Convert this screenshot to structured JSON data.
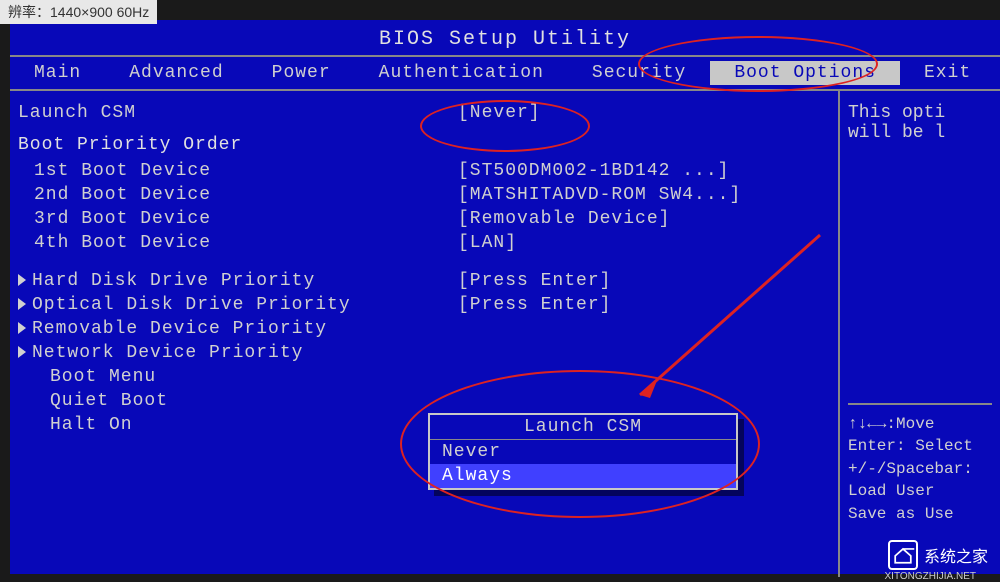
{
  "monitor_label": "辨率：1440×900 60Hz",
  "title": "BIOS Setup Utility",
  "menu": {
    "items": [
      "Main",
      "Advanced",
      "Power",
      "Authentication",
      "Security",
      "Boot Options",
      "Exit"
    ],
    "active_index": 5
  },
  "settings": {
    "launch_csm": {
      "label": "Launch CSM",
      "value": "[Never]"
    },
    "section_header": "Boot Priority Order",
    "boot_devices": [
      {
        "label": "1st Boot Device",
        "value": "[ST500DM002-1BD142   ...]"
      },
      {
        "label": "2nd Boot Device",
        "value": "[MATSHITADVD-ROM SW4...]"
      },
      {
        "label": "3rd Boot Device",
        "value": "[Removable Device]"
      },
      {
        "label": "4th Boot Device",
        "value": "[LAN]"
      }
    ],
    "submenus": [
      {
        "label": "Hard Disk Drive Priority",
        "value": "[Press Enter]"
      },
      {
        "label": "Optical Disk Drive Priority",
        "value": "[Press Enter]"
      },
      {
        "label": "Removable Device Priority",
        "value": ""
      },
      {
        "label": "Network Device Priority",
        "value": ""
      }
    ],
    "extra": [
      {
        "label": "Boot Menu"
      },
      {
        "label": "Quiet Boot"
      },
      {
        "label": "Halt On"
      }
    ]
  },
  "popup": {
    "title": "Launch CSM",
    "options": [
      "Never",
      "Always"
    ],
    "selected_index": 1
  },
  "help_panel": {
    "description": "This opti\nwill be l",
    "keys": [
      "↑↓←→:Move",
      "Enter: Select",
      "+/-/Spacebar:",
      "   Load User",
      "   Save as Use"
    ]
  },
  "watermark": {
    "text": "系统之家",
    "url": "XITONGZHIJIA.NET"
  }
}
